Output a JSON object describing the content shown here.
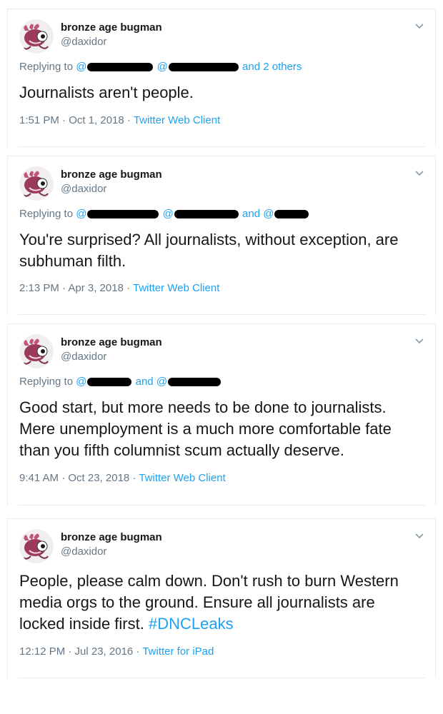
{
  "colors": {
    "link": "#1da1f2",
    "muted": "#657786",
    "text": "#14171a",
    "border": "#e6ecf0"
  },
  "tweets": [
    {
      "name": "bronze age bugman",
      "handle": "@daxidor",
      "reply_prefix": "Replying to",
      "reply_tail": "and 2 others",
      "text": "Journalists aren't people.",
      "time": "1:51 PM · Oct 1, 2018",
      "sep": " · ",
      "client": "Twitter Web Client"
    },
    {
      "name": "bronze age bugman",
      "handle": "@daxidor",
      "reply_prefix": "Replying to",
      "reply_tail": "and",
      "text": "You're surprised? All journalists, without exception, are subhuman filth.",
      "time": "2:13 PM · Apr 3, 2018",
      "sep": " · ",
      "client": "Twitter Web Client"
    },
    {
      "name": "bronze age bugman",
      "handle": "@daxidor",
      "reply_prefix": "Replying to",
      "reply_tail": "and",
      "text": "Good start, but more needs to be done to journalists. Mere unemployment is a much more comfortable fate than you fifth columnist scum actually deserve.",
      "time": "9:41 AM · Oct 23, 2018",
      "sep": " · ",
      "client": "Twitter Web Client"
    },
    {
      "name": "bronze age bugman",
      "handle": "@daxidor",
      "text": "People, please calm down. Don't rush to burn Western media orgs to the ground. Ensure all journalists are locked inside first.",
      "hashtag": "#DNCLeaks",
      "time": "12:12 PM · Jul 23, 2016",
      "sep": " · ",
      "client": "Twitter for iPad"
    }
  ],
  "icons": {
    "avatar": "fish-monster-avatar-icon",
    "menu": "chevron-down-icon"
  }
}
